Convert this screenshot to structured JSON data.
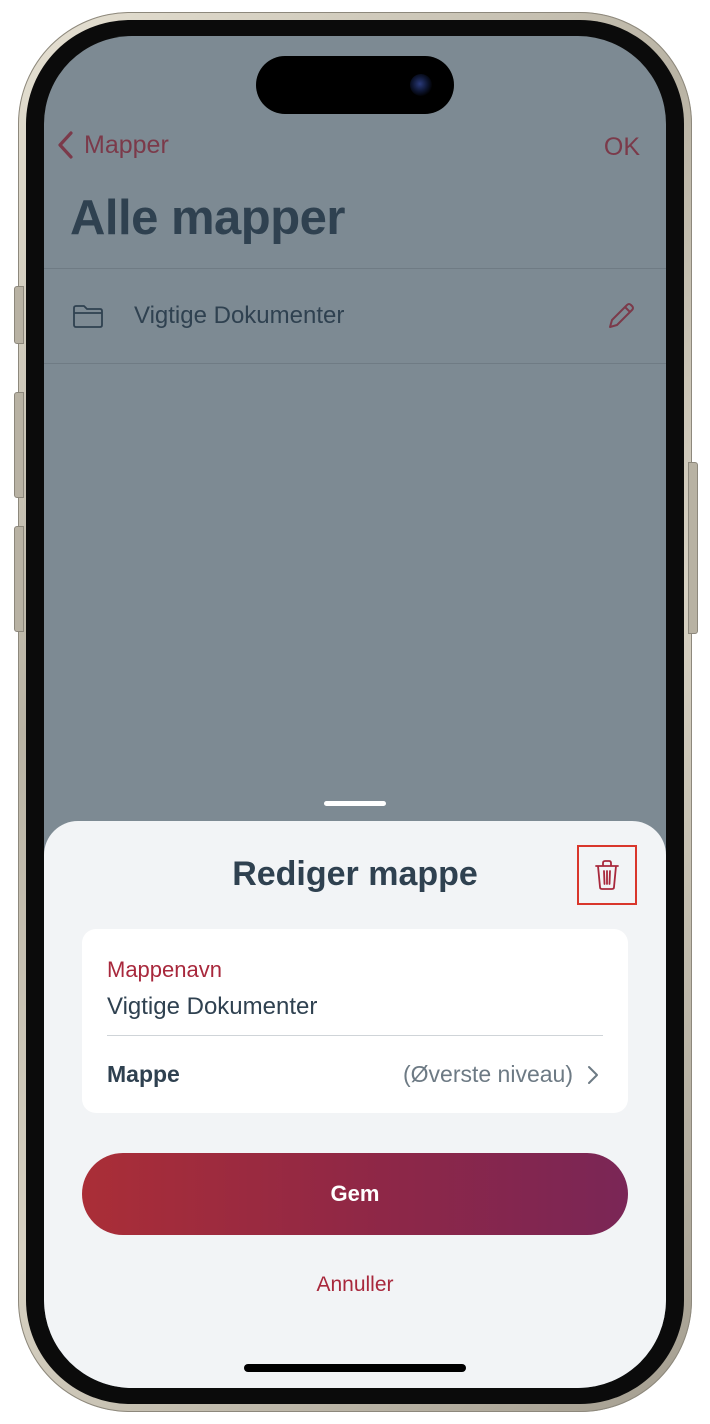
{
  "nav": {
    "back_label": "Mapper",
    "ok_label": "OK"
  },
  "page": {
    "title": "Alle mapper"
  },
  "folders": [
    {
      "name": "Vigtige Dokumenter"
    }
  ],
  "sheet": {
    "title": "Rediger mappe",
    "name_label": "Mappenavn",
    "name_value": "Vigtige Dokumenter",
    "parent_label": "Mappe",
    "parent_value": "(Øverste niveau)",
    "save_label": "Gem",
    "cancel_label": "Annuller"
  },
  "icons": {
    "back": "chevron-left-icon",
    "folder": "folder-icon",
    "edit": "pencil-icon",
    "delete": "trash-icon",
    "disclosure": "chevron-right-icon"
  },
  "colors": {
    "accent": "#a8283c",
    "text_dark": "#2f4150",
    "dim_overlay": "#7d8a93",
    "sheet_bg": "#f2f4f6",
    "button_gradient": [
      "#aa2e37",
      "#7a2656"
    ],
    "highlight_box": "#d9362b"
  }
}
